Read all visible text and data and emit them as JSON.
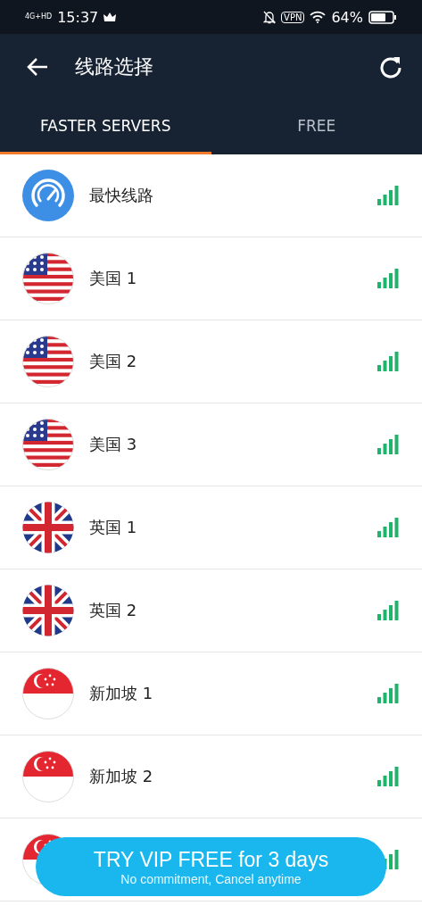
{
  "status_bar": {
    "network": "4G+HD",
    "time": "15:37",
    "vpn": "VPN",
    "battery": "64%"
  },
  "toolbar": {
    "title": "线路选择"
  },
  "tabs": [
    {
      "label": "FASTER SERVERS",
      "selected": true
    },
    {
      "label": "FREE",
      "selected": false
    }
  ],
  "servers": [
    {
      "kind": "fastest",
      "name": "最快线路"
    },
    {
      "kind": "us",
      "name": "美国 1"
    },
    {
      "kind": "us",
      "name": "美国 2"
    },
    {
      "kind": "us",
      "name": "美国 3"
    },
    {
      "kind": "uk",
      "name": "英国 1"
    },
    {
      "kind": "uk",
      "name": "英国 2"
    },
    {
      "kind": "sg",
      "name": "新加坡 1"
    },
    {
      "kind": "sg",
      "name": "新加坡 2"
    },
    {
      "kind": "sg"
    }
  ],
  "promo": {
    "title": "TRY VIP FREE for 3 days",
    "subtitle": "No commitment, Cancel anytime"
  }
}
